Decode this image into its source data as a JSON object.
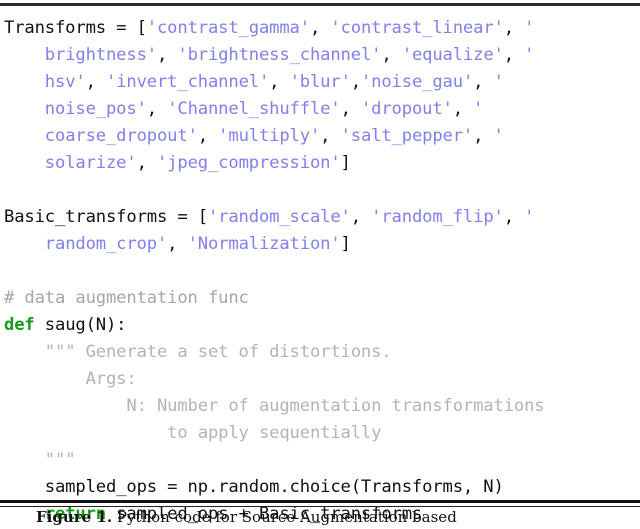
{
  "figure": {
    "kind": "code-listing",
    "language": "Python",
    "caption_label": "Figure 1.",
    "caption_text": "Python code for Source Augmentation based",
    "colors": {
      "string": "#8080ee",
      "keyword": "#1a9a1a",
      "comment": "#a6a6a6",
      "docstring": "#b4b4b4",
      "plain": "#111111",
      "rule": "#2b2b2b",
      "background": "#ffffff"
    }
  },
  "code": {
    "lines": [
      {
        "id": "line-1",
        "tokens": [
          {
            "t": "plain",
            "v": "Transforms = "
          },
          {
            "t": "punct",
            "v": "["
          },
          {
            "t": "str",
            "v": "'contrast_gamma'"
          },
          {
            "t": "punct",
            "v": ", "
          },
          {
            "t": "str",
            "v": "'contrast_linear'"
          },
          {
            "t": "punct",
            "v": ", "
          },
          {
            "t": "str",
            "v": "'"
          }
        ]
      },
      {
        "id": "line-2",
        "tokens": [
          {
            "t": "plain",
            "v": "    "
          },
          {
            "t": "str",
            "v": "brightness'"
          },
          {
            "t": "punct",
            "v": ", "
          },
          {
            "t": "str",
            "v": "'brightness_channel'"
          },
          {
            "t": "punct",
            "v": ", "
          },
          {
            "t": "str",
            "v": "'equalize'"
          },
          {
            "t": "punct",
            "v": ", "
          },
          {
            "t": "str",
            "v": "'"
          }
        ]
      },
      {
        "id": "line-3",
        "tokens": [
          {
            "t": "plain",
            "v": "    "
          },
          {
            "t": "str",
            "v": "hsv'"
          },
          {
            "t": "punct",
            "v": ", "
          },
          {
            "t": "str",
            "v": "'invert_channel'"
          },
          {
            "t": "punct",
            "v": ", "
          },
          {
            "t": "str",
            "v": "'blur'"
          },
          {
            "t": "punct",
            "v": ","
          },
          {
            "t": "str",
            "v": "'noise_gau'"
          },
          {
            "t": "punct",
            "v": ", "
          },
          {
            "t": "str",
            "v": "'"
          }
        ]
      },
      {
        "id": "line-4",
        "tokens": [
          {
            "t": "plain",
            "v": "    "
          },
          {
            "t": "str",
            "v": "noise_pos'"
          },
          {
            "t": "punct",
            "v": ", "
          },
          {
            "t": "str",
            "v": "'Channel_shuffle'"
          },
          {
            "t": "punct",
            "v": ", "
          },
          {
            "t": "str",
            "v": "'dropout'"
          },
          {
            "t": "punct",
            "v": ", "
          },
          {
            "t": "str",
            "v": "'"
          }
        ]
      },
      {
        "id": "line-5",
        "tokens": [
          {
            "t": "plain",
            "v": "    "
          },
          {
            "t": "str",
            "v": "coarse_dropout'"
          },
          {
            "t": "punct",
            "v": ", "
          },
          {
            "t": "str",
            "v": "'multiply'"
          },
          {
            "t": "punct",
            "v": ", "
          },
          {
            "t": "str",
            "v": "'salt_pepper'"
          },
          {
            "t": "punct",
            "v": ", "
          },
          {
            "t": "str",
            "v": "'"
          }
        ]
      },
      {
        "id": "line-6",
        "tokens": [
          {
            "t": "plain",
            "v": "    "
          },
          {
            "t": "str",
            "v": "solarize'"
          },
          {
            "t": "punct",
            "v": ", "
          },
          {
            "t": "str",
            "v": "'jpeg_compression'"
          },
          {
            "t": "punct",
            "v": "]"
          }
        ]
      },
      {
        "id": "line-7",
        "tokens": []
      },
      {
        "id": "line-8",
        "tokens": [
          {
            "t": "plain",
            "v": "Basic_transforms = "
          },
          {
            "t": "punct",
            "v": "["
          },
          {
            "t": "str",
            "v": "'random_scale'"
          },
          {
            "t": "punct",
            "v": ", "
          },
          {
            "t": "str",
            "v": "'random_flip'"
          },
          {
            "t": "punct",
            "v": ", "
          },
          {
            "t": "str",
            "v": "'"
          }
        ]
      },
      {
        "id": "line-9",
        "tokens": [
          {
            "t": "plain",
            "v": "    "
          },
          {
            "t": "str",
            "v": "random_crop'"
          },
          {
            "t": "punct",
            "v": ", "
          },
          {
            "t": "str",
            "v": "'Normalization'"
          },
          {
            "t": "punct",
            "v": "]"
          }
        ]
      },
      {
        "id": "line-10",
        "tokens": []
      },
      {
        "id": "line-11",
        "tokens": [
          {
            "t": "com",
            "v": "# data augmentation func"
          }
        ]
      },
      {
        "id": "line-12",
        "tokens": [
          {
            "t": "kw",
            "v": "def"
          },
          {
            "t": "plain",
            "v": " "
          },
          {
            "t": "name",
            "v": "saug"
          },
          {
            "t": "punct",
            "v": "(N):"
          }
        ]
      },
      {
        "id": "line-13",
        "tokens": [
          {
            "t": "plain",
            "v": "    "
          },
          {
            "t": "doc",
            "v": "\"\"\" Generate a set of distortions."
          }
        ]
      },
      {
        "id": "line-14",
        "tokens": [
          {
            "t": "plain",
            "v": "        "
          },
          {
            "t": "doc",
            "v": "Args:"
          }
        ]
      },
      {
        "id": "line-15",
        "tokens": [
          {
            "t": "plain",
            "v": "            "
          },
          {
            "t": "doc",
            "v": "N: Number of augmentation transformations"
          }
        ]
      },
      {
        "id": "line-16",
        "tokens": [
          {
            "t": "plain",
            "v": "                "
          },
          {
            "t": "doc",
            "v": "to apply sequentially"
          }
        ]
      },
      {
        "id": "line-17",
        "tokens": [
          {
            "t": "plain",
            "v": "    "
          },
          {
            "t": "doc",
            "v": "\"\"\""
          }
        ]
      },
      {
        "id": "line-18",
        "tokens": [
          {
            "t": "plain",
            "v": "    sampled_ops = np.random.choice(Transforms, N)"
          }
        ]
      },
      {
        "id": "line-19",
        "tokens": [
          {
            "t": "plain",
            "v": "    "
          },
          {
            "t": "kw",
            "v": "return"
          },
          {
            "t": "plain",
            "v": " sampled_ops + Basic_transforms"
          }
        ]
      }
    ]
  }
}
